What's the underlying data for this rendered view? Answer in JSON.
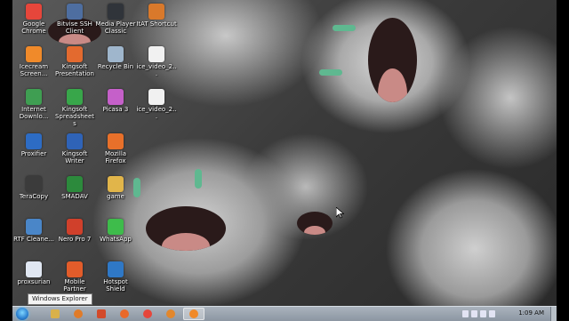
{
  "desktop": {
    "icons": [
      {
        "label": "Google Chrome",
        "color": "#e6463b",
        "glyph": "◎"
      },
      {
        "label": "Bitvise SSH Client",
        "color": "#4e6ea0",
        "glyph": "▣"
      },
      {
        "label": "Media Player Classic",
        "color": "#30343a",
        "glyph": "▶"
      },
      {
        "label": "ItAT Shortcut",
        "color": "#d9792b",
        "glyph": "✦"
      },
      {
        "label": "Icecream Screen...",
        "color": "#f08a2a",
        "glyph": "●"
      },
      {
        "label": "Kingsoft Presentation",
        "color": "#e36a2f",
        "glyph": "P"
      },
      {
        "label": "Recycle Bin",
        "color": "#9fb6cc",
        "glyph": "♻"
      },
      {
        "label": "ice_video_2...",
        "color": "#f1f1f1",
        "glyph": "▸"
      },
      {
        "label": "Internet Downlo...",
        "color": "#3f9e52",
        "glyph": "⇣"
      },
      {
        "label": "Kingsoft Spreadsheets",
        "color": "#38a64a",
        "glyph": "S"
      },
      {
        "label": "Picasa 3",
        "color": "#c560c9",
        "glyph": "✿"
      },
      {
        "label": "ice_video_2...",
        "color": "#f1f1f1",
        "glyph": "▸"
      },
      {
        "label": "Proxifier",
        "color": "#2d6cc4",
        "glyph": "◉"
      },
      {
        "label": "Kingsoft Writer",
        "color": "#2f63b7",
        "glyph": "W"
      },
      {
        "label": "Mozilla Firefox",
        "color": "#e8702a",
        "glyph": "◐"
      },
      {
        "label": "TeraCopy",
        "color": "#3b3b3b",
        "glyph": "✔"
      },
      {
        "label": "SMADAV",
        "color": "#2c8a3c",
        "glyph": "▲"
      },
      {
        "label": "game",
        "color": "#e1b54a",
        "glyph": "▬"
      },
      {
        "label": "RTF Cleane...",
        "color": "#4a86c8",
        "glyph": "✎"
      },
      {
        "label": "Nero Pro 7",
        "color": "#d0402b",
        "glyph": "N"
      },
      {
        "label": "WhatsApp",
        "color": "#3ebc4b",
        "glyph": "✆"
      },
      {
        "label": "proxsurian",
        "color": "#e0e7f2",
        "glyph": "▤"
      },
      {
        "label": "Mobile Partner",
        "color": "#e25c2a",
        "glyph": "◍"
      },
      {
        "label": "Hotspot Shield",
        "color": "#2f78c6",
        "glyph": "⛨"
      }
    ]
  },
  "tooltip": {
    "text": "Windows Explorer"
  },
  "taskbar": {
    "pinned": [
      {
        "name": "windows-explorer",
        "color": "#d9b14a"
      },
      {
        "name": "media-player",
        "color": "#e07b29"
      },
      {
        "name": "kingsoft",
        "color": "#d34a2a"
      },
      {
        "name": "mozilla-firefox",
        "color": "#e9692a"
      },
      {
        "name": "google-chrome",
        "color": "#e6463b"
      },
      {
        "name": "media-player-classic",
        "color": "#e2872d"
      },
      {
        "name": "icecream-screen-recorder",
        "color": "#f08a2a"
      }
    ],
    "clock": "1:09 AM"
  }
}
